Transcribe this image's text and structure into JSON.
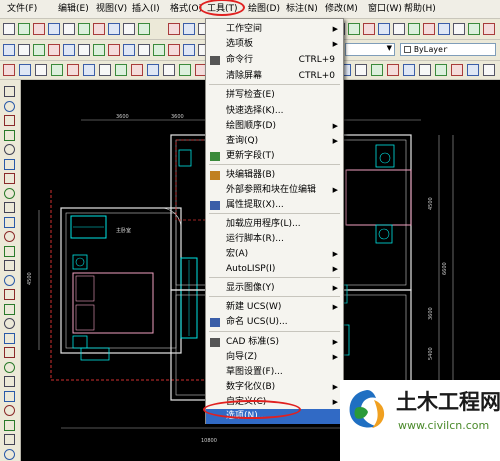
{
  "menubar": {
    "items": [
      "文件(F)",
      "编辑(E)",
      "视图(V)",
      "插入(I)",
      "格式(O)",
      "工具(T)",
      "绘图(D)",
      "标注(N)",
      "修改(M)",
      "窗口(W)",
      "帮助(H)"
    ]
  },
  "layer_combo": {
    "value": "ByLayer"
  },
  "tools_menu": {
    "items": [
      {
        "label": "工作空间",
        "shortcut": "",
        "submenu": true
      },
      {
        "label": "选项板",
        "shortcut": "",
        "submenu": true
      },
      {
        "label": "命令行",
        "shortcut": "CTRL+9",
        "submenu": false
      },
      {
        "label": "清除屏幕",
        "shortcut": "CTRL+0",
        "submenu": false
      },
      {
        "label": "拼写检查(E)",
        "shortcut": "",
        "submenu": false
      },
      {
        "label": "快速选择(K)...",
        "shortcut": "",
        "submenu": false
      },
      {
        "label": "绘图顺序(D)",
        "shortcut": "",
        "submenu": true
      },
      {
        "label": "查询(Q)",
        "shortcut": "",
        "submenu": true
      },
      {
        "label": "更新字段(T)",
        "shortcut": "",
        "submenu": false
      },
      {
        "label": "块编辑器(B)",
        "shortcut": "",
        "submenu": false
      },
      {
        "label": "外部参照和块在位编辑",
        "shortcut": "",
        "submenu": true
      },
      {
        "label": "属性提取(X)...",
        "shortcut": "",
        "submenu": false
      },
      {
        "label": "加载应用程序(L)...",
        "shortcut": "",
        "submenu": false
      },
      {
        "label": "运行脚本(R)...",
        "shortcut": "",
        "submenu": false
      },
      {
        "label": "宏(A)",
        "shortcut": "",
        "submenu": true
      },
      {
        "label": "AutoLISP(I)",
        "shortcut": "",
        "submenu": true
      },
      {
        "label": "显示图像(Y)",
        "shortcut": "",
        "submenu": true
      },
      {
        "label": "新建 UCS(W)",
        "shortcut": "",
        "submenu": true
      },
      {
        "label": "命名 UCS(U)...",
        "shortcut": "",
        "submenu": false
      },
      {
        "label": "CAD 标准(S)",
        "shortcut": "",
        "submenu": true
      },
      {
        "label": "向导(Z)",
        "shortcut": "",
        "submenu": true
      },
      {
        "label": "草图设置(F)...",
        "shortcut": "",
        "submenu": false
      },
      {
        "label": "数字化仪(B)",
        "shortcut": "",
        "submenu": true
      },
      {
        "label": "自定义(C)",
        "shortcut": "",
        "submenu": true
      },
      {
        "label": "选项(N)...",
        "shortcut": "",
        "submenu": false
      }
    ]
  },
  "drawing": {
    "dims": [
      "3600",
      "3600",
      "4500",
      "2400",
      "10800",
      "4500",
      "1200",
      "3600",
      "3100",
      "4500",
      "6600",
      "5400",
      "3000"
    ],
    "room_label": "主卧室"
  },
  "watermark": {
    "title": "土木工程网",
    "url": "www.civilcn.com"
  }
}
